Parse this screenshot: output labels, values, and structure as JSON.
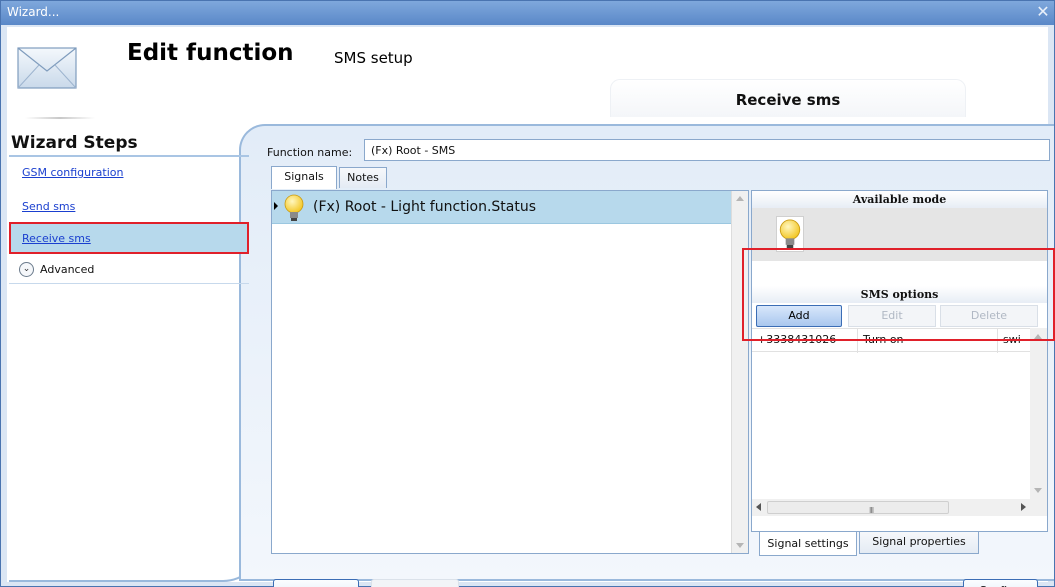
{
  "window": {
    "title": "Wizard...",
    "close_icon": "close-icon"
  },
  "header": {
    "title": "Edit function",
    "subtitle": "SMS setup",
    "section_tab": "Receive sms"
  },
  "wizard_steps": {
    "title": "Wizard Steps",
    "items": [
      {
        "label": "GSM configuration"
      },
      {
        "label": "Send sms"
      },
      {
        "label": "Receive sms",
        "selected": true
      }
    ],
    "advanced_label": "Advanced"
  },
  "function_name": {
    "label": "Function name:",
    "value": "(Fx) Root - SMS"
  },
  "tabs": {
    "signals": "Signals",
    "notes": "Notes"
  },
  "signals": [
    {
      "text": "(Fx) Root - Light function.Status",
      "icon": "bulb-icon"
    }
  ],
  "right_panel": {
    "available_mode_title": "Available mode",
    "sms_options_title": "SMS options",
    "buttons": {
      "add": "Add",
      "edit": "Edit",
      "delete": "Delete"
    },
    "rows": [
      {
        "number": "+3338431026",
        "action": "Turn on",
        "text": "swi"
      }
    ],
    "hscroll_grip": "III",
    "tabs": {
      "signal_settings": "Signal settings",
      "signal_properties": "Signal properties"
    }
  },
  "footer": {
    "back": "<<<",
    "next": ">>>",
    "confirm": "Confirm"
  },
  "colors": {
    "highlight_outline": "#e0202a",
    "selection_bg": "#b7d9ec",
    "frame_border": "#9ab9dc"
  }
}
